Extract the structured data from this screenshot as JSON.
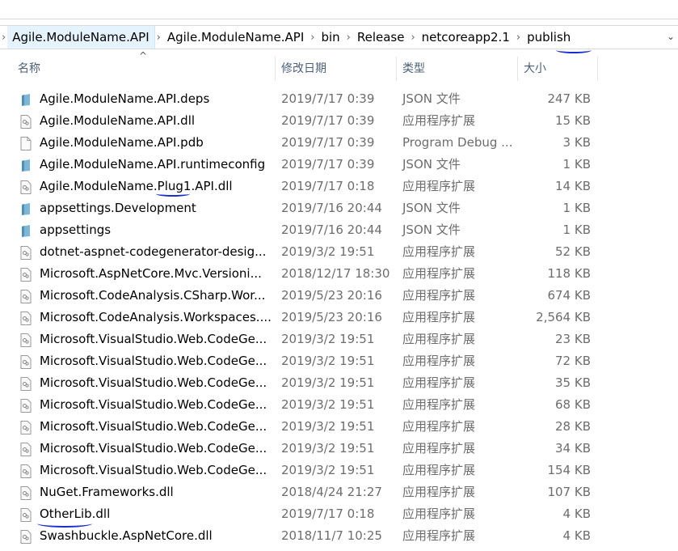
{
  "breadcrumb": [
    "Agile.ModuleName.API",
    "Agile.ModuleName.API",
    "bin",
    "Release",
    "netcoreapp2.1",
    "publish"
  ],
  "columns": {
    "name": "名称",
    "date": "修改日期",
    "type": "类型",
    "size": "大小"
  },
  "files": [
    {
      "name": "Agile.ModuleName.API.deps",
      "date": "2019/7/17 0:39",
      "type": "JSON 文件",
      "size": "247 KB",
      "icon": "json"
    },
    {
      "name": "Agile.ModuleName.API.dll",
      "date": "2019/7/17 0:39",
      "type": "应用程序扩展",
      "size": "15 KB",
      "icon": "dll"
    },
    {
      "name": "Agile.ModuleName.API.pdb",
      "date": "2019/7/17 0:39",
      "type": "Program Debug ...",
      "size": "3 KB",
      "icon": "file"
    },
    {
      "name": "Agile.ModuleName.API.runtimeconfig",
      "date": "2019/7/17 0:39",
      "type": "JSON 文件",
      "size": "1 KB",
      "icon": "json"
    },
    {
      "name": "Agile.ModuleName.Plug1.API.dll",
      "date": "2019/7/17 0:18",
      "type": "应用程序扩展",
      "size": "14 KB",
      "icon": "dll"
    },
    {
      "name": "appsettings.Development",
      "date": "2019/7/16 20:44",
      "type": "JSON 文件",
      "size": "1 KB",
      "icon": "json"
    },
    {
      "name": "appsettings",
      "date": "2019/7/16 20:44",
      "type": "JSON 文件",
      "size": "1 KB",
      "icon": "json"
    },
    {
      "name": "dotnet-aspnet-codegenerator-desig...",
      "date": "2019/3/2 19:51",
      "type": "应用程序扩展",
      "size": "52 KB",
      "icon": "dll"
    },
    {
      "name": "Microsoft.AspNetCore.Mvc.Versioni...",
      "date": "2018/12/17 18:30",
      "type": "应用程序扩展",
      "size": "118 KB",
      "icon": "dll"
    },
    {
      "name": "Microsoft.CodeAnalysis.CSharp.Wor...",
      "date": "2019/5/23 20:16",
      "type": "应用程序扩展",
      "size": "674 KB",
      "icon": "dll"
    },
    {
      "name": "Microsoft.CodeAnalysis.Workspaces....",
      "date": "2019/5/23 20:16",
      "type": "应用程序扩展",
      "size": "2,564 KB",
      "icon": "dll"
    },
    {
      "name": "Microsoft.VisualStudio.Web.CodeGe...",
      "date": "2019/3/2 19:51",
      "type": "应用程序扩展",
      "size": "23 KB",
      "icon": "dll"
    },
    {
      "name": "Microsoft.VisualStudio.Web.CodeGe...",
      "date": "2019/3/2 19:51",
      "type": "应用程序扩展",
      "size": "72 KB",
      "icon": "dll"
    },
    {
      "name": "Microsoft.VisualStudio.Web.CodeGe...",
      "date": "2019/3/2 19:51",
      "type": "应用程序扩展",
      "size": "35 KB",
      "icon": "dll"
    },
    {
      "name": "Microsoft.VisualStudio.Web.CodeGe...",
      "date": "2019/3/2 19:51",
      "type": "应用程序扩展",
      "size": "68 KB",
      "icon": "dll"
    },
    {
      "name": "Microsoft.VisualStudio.Web.CodeGe...",
      "date": "2019/3/2 19:51",
      "type": "应用程序扩展",
      "size": "28 KB",
      "icon": "dll"
    },
    {
      "name": "Microsoft.VisualStudio.Web.CodeGe...",
      "date": "2019/3/2 19:51",
      "type": "应用程序扩展",
      "size": "34 KB",
      "icon": "dll"
    },
    {
      "name": "Microsoft.VisualStudio.Web.CodeGe...",
      "date": "2019/3/2 19:51",
      "type": "应用程序扩展",
      "size": "154 KB",
      "icon": "dll"
    },
    {
      "name": "NuGet.Frameworks.dll",
      "date": "2018/4/24 21:27",
      "type": "应用程序扩展",
      "size": "107 KB",
      "icon": "dll"
    },
    {
      "name": "OtherLib.dll",
      "date": "2019/7/17 0:18",
      "type": "应用程序扩展",
      "size": "4 KB",
      "icon": "dll"
    },
    {
      "name": "Swashbuckle.AspNetCore.dll",
      "date": "2018/11/7 10:25",
      "type": "应用程序扩展",
      "size": "4 KB",
      "icon": "dll"
    }
  ]
}
